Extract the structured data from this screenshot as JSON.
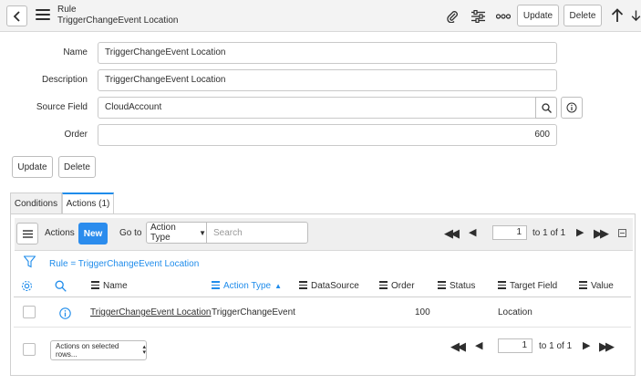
{
  "header": {
    "record_type": "Rule",
    "record_name": "TriggerChangeEvent Location",
    "update_label": "Update",
    "delete_label": "Delete"
  },
  "form": {
    "name_label": "Name",
    "name_value": "TriggerChangeEvent Location",
    "description_label": "Description",
    "description_value": "TriggerChangeEvent Location",
    "source_field_label": "Source Field",
    "source_field_value": "CloudAccount",
    "order_label": "Order",
    "order_value": "600",
    "update_label": "Update",
    "delete_label": "Delete"
  },
  "tabs": [
    {
      "label": "Conditions"
    },
    {
      "label": "Actions (1)"
    }
  ],
  "list": {
    "title": "Actions",
    "new_label": "New",
    "goto_label": "Go to",
    "goto_field": "Action Type",
    "search_placeholder": "Search",
    "page_value": "1",
    "page_of": "to 1 of 1",
    "filter_text": "Rule = TriggerChangeEvent Location",
    "columns": [
      "Name",
      "Action Type",
      "DataSource",
      "Order",
      "Status",
      "Target Field",
      "Value"
    ],
    "rows": [
      {
        "name": "TriggerChangeEvent Location",
        "action_type": "TriggerChangeEvent",
        "datasource": "",
        "order": "100",
        "status": "",
        "target_field": "Location",
        "value": ""
      }
    ],
    "actions_select": "Actions on selected rows...",
    "bottom_page_value": "1",
    "bottom_page_of": "to 1 of 1"
  },
  "colors": {
    "accent": "#1f8ceb",
    "new_button": "#2b8ced"
  }
}
